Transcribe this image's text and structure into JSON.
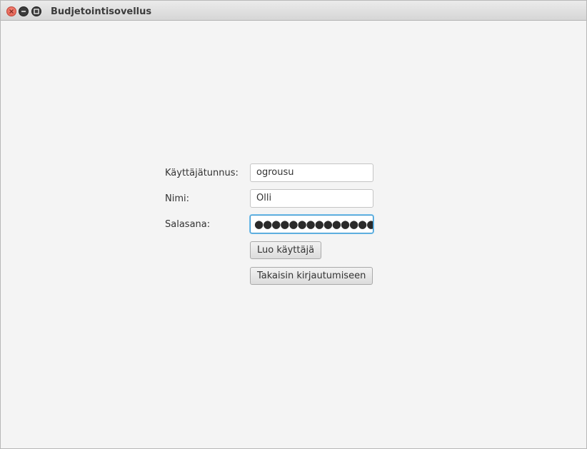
{
  "window": {
    "title": "Budjetointisovellus"
  },
  "form": {
    "username_label": "Käyttäjätunnus:",
    "username_value": "ogrousu",
    "name_label": "Nimi:",
    "name_value": "Olli",
    "password_label": "Salasana:",
    "password_mask": "●●●●●●●●●●●●●●",
    "create_button": "Luo käyttäjä",
    "back_button": "Takaisin kirjautumiseen"
  },
  "colors": {
    "background": "#f4f4f4",
    "focus_border": "#3a97d0",
    "close_button": "#e0584a"
  },
  "icons": {
    "close": "close-icon",
    "minimize": "minimize-icon",
    "maximize": "maximize-icon"
  }
}
